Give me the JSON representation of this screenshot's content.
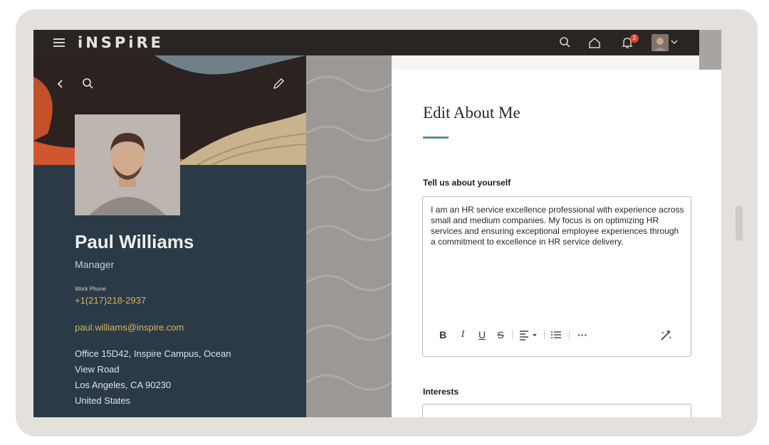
{
  "header": {
    "logo": "iNSPiRE",
    "notification_count": "2"
  },
  "profile": {
    "name": "Paul Williams",
    "role": "Manager",
    "work_phone_label": "Work Phone",
    "work_phone": "+1(217)218-2937",
    "email": "paul.williams@inspire.com",
    "address_lines": [
      "Office 15D42, Inspire Campus, Ocean",
      "View Road",
      "Los Angeles, CA 90230",
      "United States"
    ]
  },
  "edit": {
    "title": "Edit About Me",
    "about_label": "Tell us about yourself",
    "about_text": "I am an HR service excellence professional with experience across small and medium companies. My focus is on optimizing HR services and ensuring exceptional employee experiences through a commitment to excellence in HR service delivery.",
    "interests_label": "Interests"
  },
  "toolbar": {
    "bold": "B",
    "italic": "I",
    "underline": "U",
    "strikethrough": "S",
    "more": "···"
  },
  "colors": {
    "topbar": "#2a2522",
    "profile_panel": "#2a3a47",
    "link_gold": "#d8b45e",
    "accent_rule": "#5e8f9c"
  }
}
